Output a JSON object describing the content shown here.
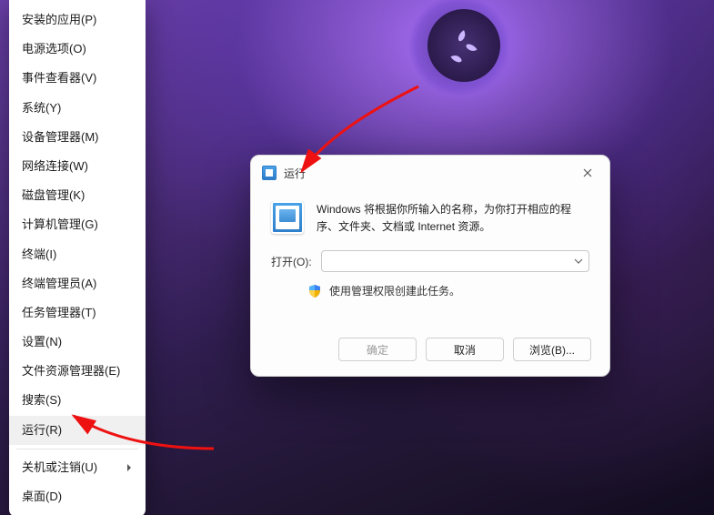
{
  "menu": {
    "items": [
      "安装的应用(P)",
      "电源选项(O)",
      "事件查看器(V)",
      "系统(Y)",
      "设备管理器(M)",
      "网络连接(W)",
      "磁盘管理(K)",
      "计算机管理(G)",
      "终端(I)",
      "终端管理员(A)",
      "任务管理器(T)",
      "设置(N)",
      "文件资源管理器(E)",
      "搜索(S)",
      "运行(R)",
      "关机或注销(U)",
      "桌面(D)"
    ],
    "highlight_index": 14,
    "separator_before": [
      15
    ]
  },
  "dialog": {
    "title": "运行",
    "description": "Windows 将根据你所输入的名称，为你打开相应的程序、文件夹、文档或 Internet 资源。",
    "open_label": "打开(O):",
    "input_value": "",
    "admin_note": "使用管理权限创建此任务。",
    "buttons": {
      "ok": "确定",
      "cancel": "取消",
      "browse": "浏览(B)..."
    }
  }
}
